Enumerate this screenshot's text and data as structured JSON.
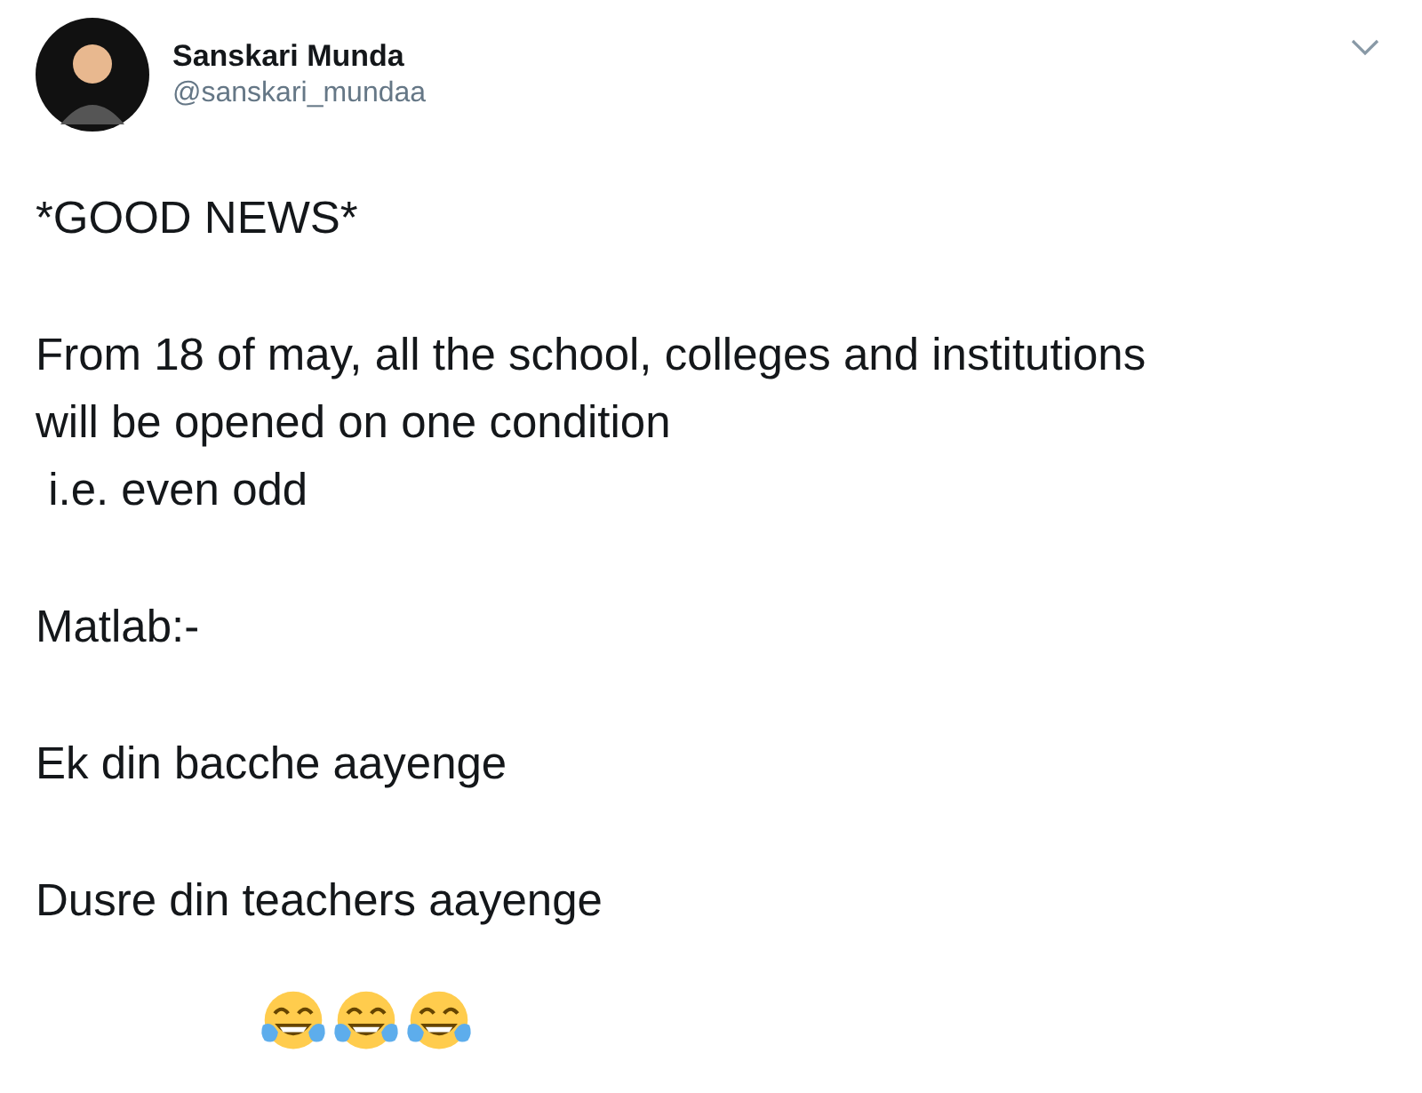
{
  "tweet": {
    "author": {
      "name": "Sanskari Munda",
      "handle": "@sanskari_mundaa"
    },
    "paragraphs": [
      [
        "*GOOD NEWS*"
      ],
      [
        "From 18 of may, all the school, colleges and institutions",
        "will be opened on one condition",
        " i.e. even odd"
      ],
      [
        "Matlab:-"
      ],
      [
        "Ek din bacche aayenge"
      ],
      [
        "Dusre din teachers aayenge"
      ]
    ]
  }
}
